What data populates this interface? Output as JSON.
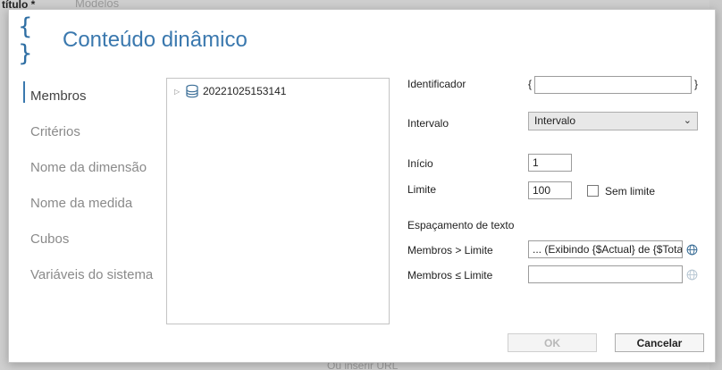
{
  "background": {
    "field_label": "título *",
    "field_value": "Modelos",
    "link": "Ou inserir URL"
  },
  "dialog": {
    "icon": "curly-braces-icon",
    "title": "Conteúdo dinâmico",
    "nav": [
      {
        "label": "Membros",
        "active": true
      },
      {
        "label": "Critérios",
        "active": false
      },
      {
        "label": "Nome da dimensão",
        "active": false
      },
      {
        "label": "Nome da medida",
        "active": false
      },
      {
        "label": "Cubos",
        "active": false
      },
      {
        "label": "Variáveis do sistema",
        "active": false
      }
    ],
    "tree": {
      "node_label": "20221025153141",
      "node_icon": "database-icon"
    },
    "form": {
      "identifier_label": "Identificador",
      "identifier_open": "{",
      "identifier_close": "}",
      "identifier_value": "",
      "interval_label": "Intervalo",
      "interval_selected": "Intervalo",
      "start_label": "Início",
      "start_value": "1",
      "limit_label": "Limite",
      "limit_value": "100",
      "no_limit_label": "Sem limite",
      "no_limit_checked": false,
      "spacing_label": "Espaçamento de texto",
      "members_gt_label": "Membros > Limite",
      "members_gt_value": "... (Exibindo {$Actual} de {$Total})",
      "members_le_label": "Membros ≤ Limite",
      "members_le_value": ""
    },
    "buttons": {
      "ok": "OK",
      "cancel": "Cancelar"
    },
    "colors": {
      "accent": "#3a78ae",
      "icon": "#2e6ea3"
    }
  }
}
